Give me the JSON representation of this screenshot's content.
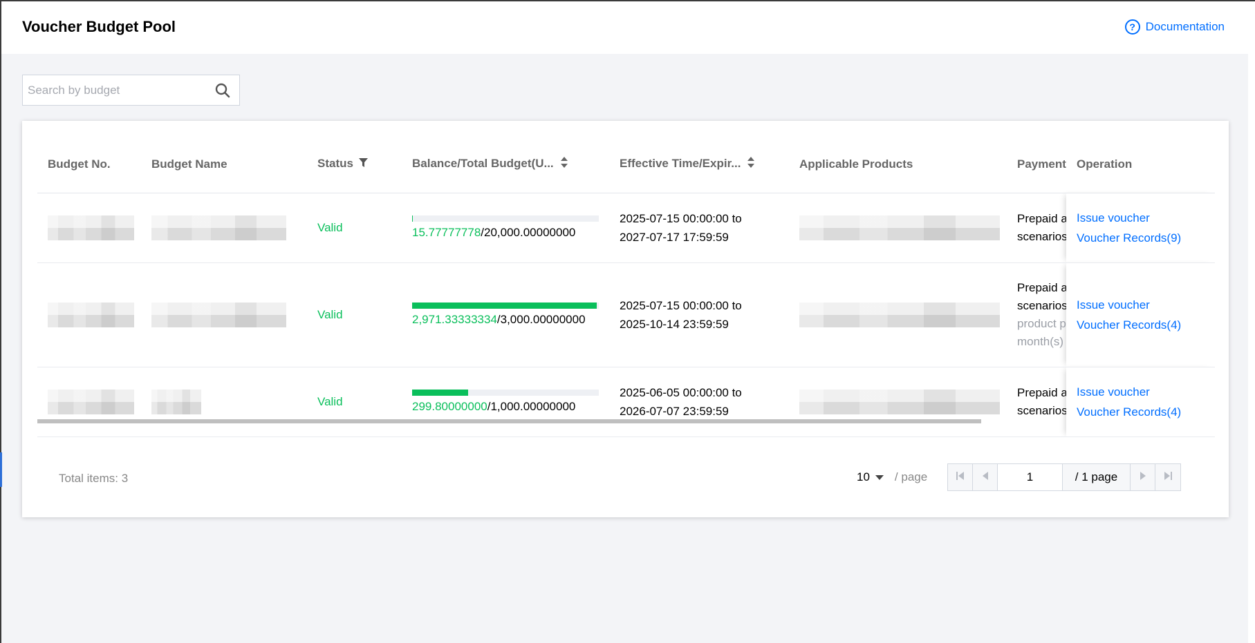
{
  "header": {
    "title": "Voucher Budget Pool",
    "doc_link": "Documentation"
  },
  "search": {
    "placeholder": "Search by budget"
  },
  "table": {
    "columns": {
      "budget_no": "Budget No.",
      "budget_name": "Budget Name",
      "status": "Status",
      "balance": "Balance/Total Budget(U...",
      "effective": "Effective Time/Expir...",
      "products": "Applicable Products",
      "payment": "Payment",
      "operation": "Operation"
    },
    "rows": [
      {
        "status": "Valid",
        "balance": "15.77777778",
        "total": "/20,000.00000000",
        "fill": 0.0008,
        "time_start": "2025-07-15 00:00:00 to",
        "time_end": "2027-07-17 17:59:59",
        "payment_1": "Prepaid a",
        "payment_2": "scenarios",
        "op_issue": "Issue voucher",
        "op_records": "Voucher Records(9)"
      },
      {
        "status": "Valid",
        "balance": "2,971.33333334",
        "total": "/3,000.00000000",
        "fill": 0.99,
        "time_start": "2025-07-15 00:00:00 to",
        "time_end": "2025-10-14 23:59:59",
        "payment_1": "Prepaid a",
        "payment_2": "scenarios",
        "payment_3": "product p",
        "payment_4": "month(s)",
        "op_issue": "Issue voucher",
        "op_records": "Voucher Records(4)"
      },
      {
        "status": "Valid",
        "balance": "299.80000000",
        "total": "/1,000.00000000",
        "fill": 0.3,
        "time_start": "2025-06-05 00:00:00 to",
        "time_end": "2026-07-07 23:59:59",
        "payment_1": "Prepaid a",
        "payment_2": "scenarios",
        "op_issue": "Issue voucher",
        "op_records": "Voucher Records(4)"
      }
    ]
  },
  "footer": {
    "total_label": "Total items:  3",
    "page_size": "10",
    "per_page": "/ page",
    "current_page": "1",
    "total_pages": "/ 1 page"
  },
  "colors": {
    "accent": "#006eff",
    "valid": "#0abf5b"
  }
}
